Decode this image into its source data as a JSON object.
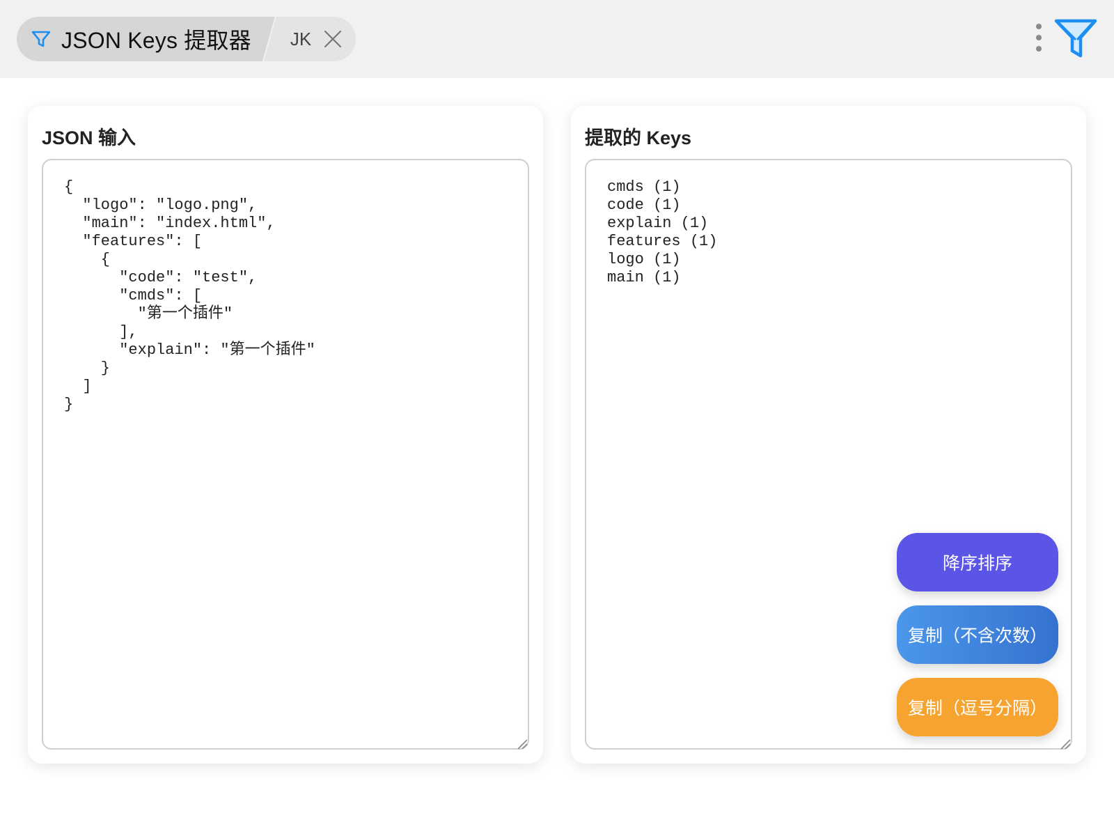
{
  "header": {
    "tab_title": "JSON Keys 提取器",
    "tab_short": "JK",
    "icons": {
      "tab": "filter-icon",
      "close": "close-icon",
      "more": "more-vertical-icon",
      "brand": "filter-icon"
    }
  },
  "input_panel": {
    "title": "JSON 输入",
    "content": "{\n  \"logo\": \"logo.png\",\n  \"main\": \"index.html\",\n  \"features\": [\n    {\n      \"code\": \"test\",\n      \"cmds\": [\n        \"第一个插件\"\n      ],\n      \"explain\": \"第一个插件\"\n    }\n  ]\n}"
  },
  "output_panel": {
    "title": "提取的 Keys",
    "content": "cmds (1)\ncode (1)\nexplain (1)\nfeatures (1)\nlogo (1)\nmain (1)"
  },
  "actions": {
    "sort_label": "降序排序",
    "copy_plain_label": "复制（不含次数）",
    "copy_comma_label": "复制（逗号分隔）"
  },
  "colors": {
    "accent_filter": "#1e8ff0",
    "sort_button": "#5a55e6",
    "copy_plain_button_start": "#4b97ea",
    "copy_plain_button_end": "#3572d0",
    "copy_comma_button": "#f6a330",
    "topbar_background": "#f1f1f1"
  }
}
